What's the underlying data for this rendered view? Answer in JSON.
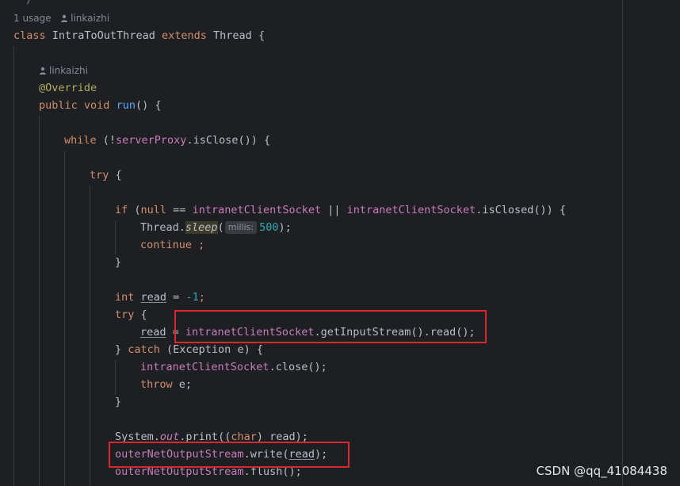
{
  "editor": {
    "comment_close": " */",
    "usage_count": "1 usage",
    "author_class": "linkaizhi",
    "author_method": "linkaizhi",
    "code": {
      "class_kw": "class",
      "class_name": "IntraToOutThread",
      "extends_kw": "extends",
      "super_name": "Thread",
      "brace_open": "{",
      "override": "@Override",
      "public_kw": "public",
      "void_kw": "void",
      "run_fn": "run",
      "run_sig_rest": "() {",
      "while_kw": "while",
      "while_open": " (!",
      "server_proxy": "serverProxy",
      "is_close_call": ".isClose()) {",
      "try_kw": "try",
      "try_brace": " {",
      "if_kw": "if",
      "if_paren": " (",
      "null_kw": "null",
      "eq_op": " == ",
      "intranet_socket": "intranetClientSocket",
      "or_op": " || ",
      "is_closed_call": ".isClosed()) {",
      "thread_ref": "Thread.",
      "sleep_fn": "sleep",
      "sleep_open": "(",
      "millis_hint": "millis:",
      "sleep_value": "500",
      "sleep_close": ");",
      "continue_kw": "continue ;",
      "close_brace": "}",
      "int_kw": "int",
      "read_var": "read",
      "init_eq": " = ",
      "neg_one": "-1",
      "semicolon": ";",
      "try_open": "try {",
      "assign_eq": " = ",
      "get_input_call": ".getInputStream().read();",
      "catch_prefix": "} ",
      "catch_kw": "catch",
      "catch_params": " (Exception e) {",
      "close_call": ".close();",
      "throw_kw": "throw",
      "throw_rest": " e;",
      "system_ref": "System.",
      "out_field": "out",
      "print_open": ".print((",
      "char_kw": "char",
      "print_rest": ") read);",
      "outer_stream": "outerNetOutputStream",
      "write_open": ".write(",
      "write_arg": "read",
      "write_close": ");",
      "flush_call": ".flush();"
    }
  },
  "watermark": "CSDN @qq_41084438",
  "colors": {
    "background": "#1e1f22",
    "keyword": "#cf8e6d",
    "field": "#c77dbb",
    "function": "#56a8f5",
    "number": "#2aacb8",
    "annotation": "#b3ae60",
    "highlight_box": "#d9272e"
  }
}
